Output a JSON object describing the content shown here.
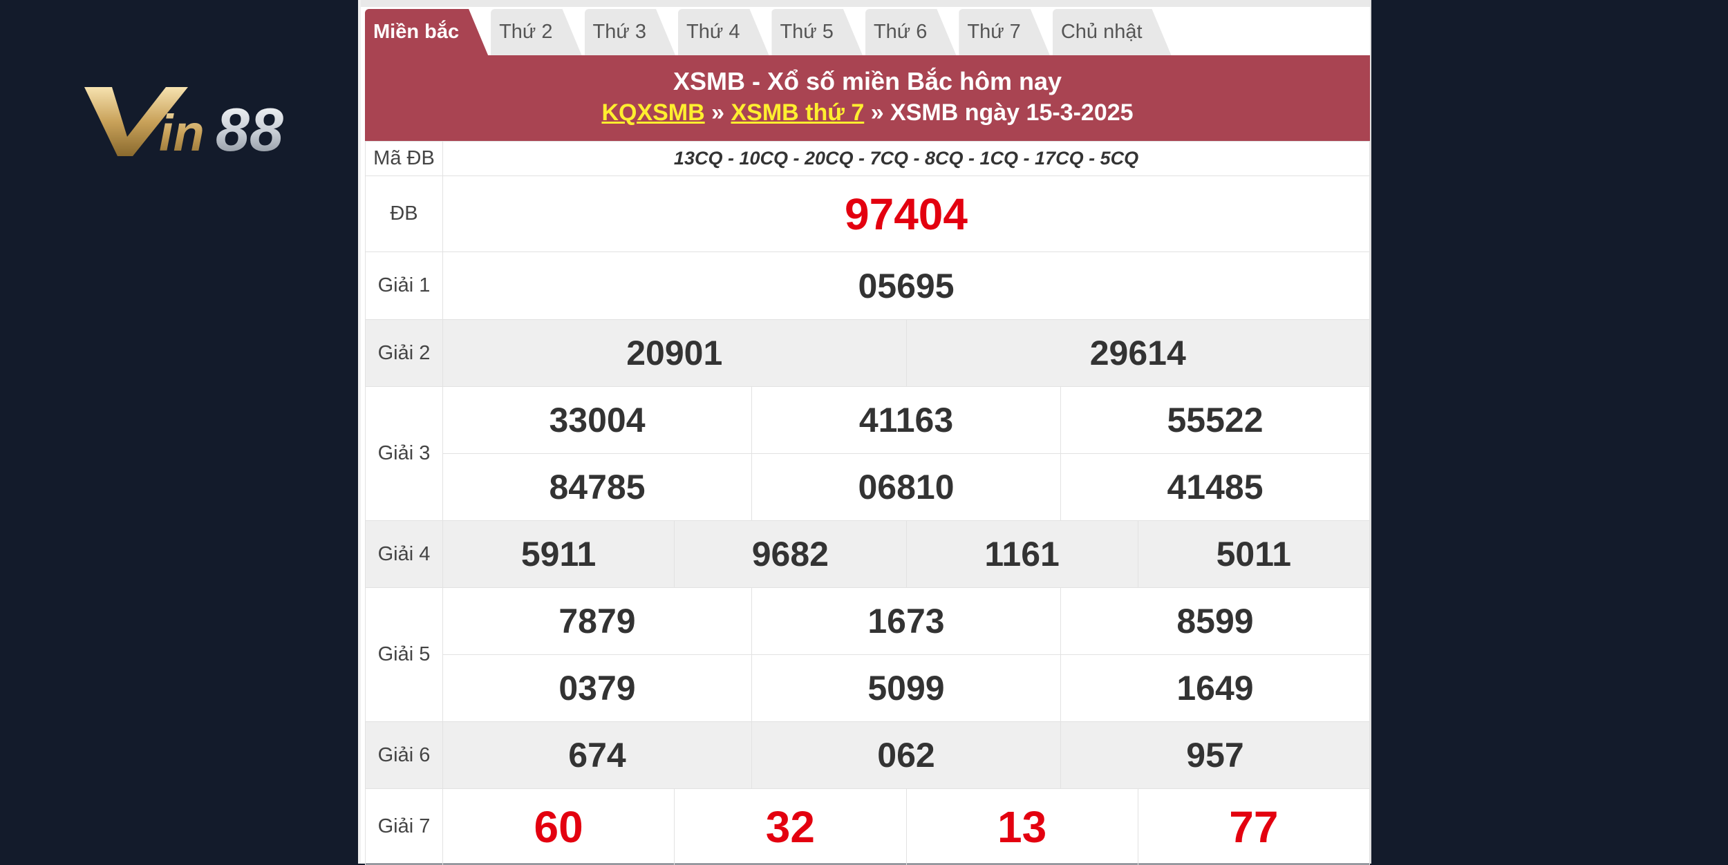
{
  "brand": {
    "logo_text": "Vin88"
  },
  "tabs": [
    {
      "label": "Miền bắc",
      "active": true
    },
    {
      "label": "Thứ 2",
      "active": false
    },
    {
      "label": "Thứ 3",
      "active": false
    },
    {
      "label": "Thứ 4",
      "active": false
    },
    {
      "label": "Thứ 5",
      "active": false
    },
    {
      "label": "Thứ 6",
      "active": false
    },
    {
      "label": "Thứ 7",
      "active": false
    },
    {
      "label": "Chủ nhật",
      "active": false
    }
  ],
  "header": {
    "title": "XSMB - Xổ số miền Bắc hôm nay",
    "breadcrumb_1": "KQXSMB",
    "sep": "»",
    "breadcrumb_2": "XSMB thứ 7",
    "current": "» XSMB ngày 15-3-2025"
  },
  "labels": {
    "madb": "Mã ĐB",
    "db": "ĐB",
    "g1": "Giải 1",
    "g2": "Giải 2",
    "g3": "Giải 3",
    "g4": "Giải 4",
    "g5": "Giải 5",
    "g6": "Giải 6",
    "g7": "Giải 7"
  },
  "results": {
    "madb": "13CQ - 10CQ - 20CQ - 7CQ - 8CQ - 1CQ - 17CQ - 5CQ",
    "db": "97404",
    "g1": "05695",
    "g2": [
      "20901",
      "29614"
    ],
    "g3": [
      "33004",
      "41163",
      "55522",
      "84785",
      "06810",
      "41485"
    ],
    "g4": [
      "5911",
      "9682",
      "1161",
      "5011"
    ],
    "g5": [
      "7879",
      "1673",
      "8599",
      "0379",
      "5099",
      "1649"
    ],
    "g6": [
      "674",
      "062",
      "957"
    ],
    "g7": [
      "60",
      "32",
      "13",
      "77"
    ]
  },
  "colors": {
    "header_bg": "#a94452",
    "accent_red": "#e3000f",
    "link_yellow": "#ffef2f",
    "page_bg": "#131b2b"
  }
}
